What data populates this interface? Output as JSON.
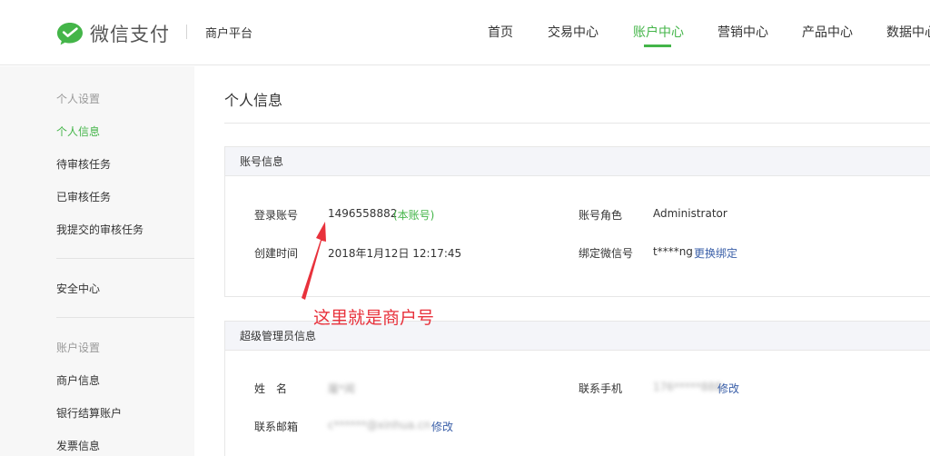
{
  "header": {
    "logo_text": "微信支付",
    "platform": "商户平台",
    "nav": [
      {
        "label": "首页",
        "active": false
      },
      {
        "label": "交易中心",
        "active": false
      },
      {
        "label": "账户中心",
        "active": true
      },
      {
        "label": "营销中心",
        "active": false
      },
      {
        "label": "产品中心",
        "active": false
      },
      {
        "label": "数据中心",
        "active": false
      }
    ]
  },
  "sidebar": {
    "groups": [
      {
        "title": "个人设置",
        "items": [
          "个人信息",
          "待审核任务",
          "已审核任务",
          "我提交的审核任务"
        ]
      },
      {
        "title": "",
        "items": [
          "安全中心"
        ]
      },
      {
        "title": "账户设置",
        "items": [
          "商户信息",
          "银行结算账户",
          "发票信息"
        ]
      }
    ],
    "active_item": "个人信息"
  },
  "main": {
    "title": "个人信息",
    "account_panel": {
      "title": "账号信息",
      "login_label": "登录账号",
      "login_value": "1496558882",
      "login_note": "(本账号)",
      "role_label": "账号角色",
      "role_value": "Administrator",
      "created_label": "创建时间",
      "created_value": "2018年1月12日 12:17:45",
      "wechat_label": "绑定微信号",
      "wechat_value": "t****ng",
      "wechat_action": "更换绑定"
    },
    "admin_panel": {
      "title": "超级管理员信息",
      "name_label": "姓　名",
      "name_value": "屠*闻",
      "phone_label": "联系手机",
      "phone_value": "176*****888",
      "phone_action": "修改",
      "email_label": "联系邮箱",
      "email_value": "c******@xinhua.cn",
      "email_action": "修改"
    }
  },
  "annotation": {
    "text": "这里就是商户号",
    "color": "#e8323c"
  },
  "colors": {
    "brand_green": "#44b549",
    "link_blue": "#3a5fa8"
  }
}
